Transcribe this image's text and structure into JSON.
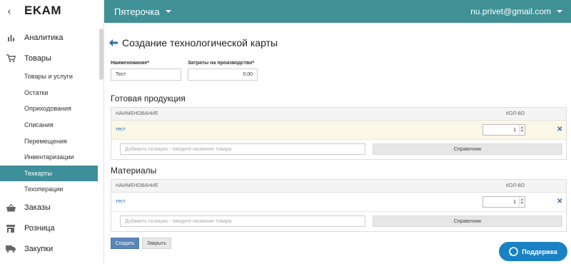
{
  "sidebar": {
    "back_glyph": "‹",
    "logo": "EKAM",
    "items": [
      {
        "label": "Аналитика",
        "icon": "bar-chart-icon",
        "type": "main"
      },
      {
        "label": "Товары",
        "icon": "cart-icon",
        "type": "main"
      },
      {
        "label": "Товары и услуги",
        "type": "sub"
      },
      {
        "label": "Остатки",
        "type": "sub"
      },
      {
        "label": "Оприходования",
        "type": "sub"
      },
      {
        "label": "Списания",
        "type": "sub"
      },
      {
        "label": "Перемещения",
        "type": "sub"
      },
      {
        "label": "Инвентаризации",
        "type": "sub"
      },
      {
        "label": "Техкарты",
        "type": "sub",
        "active": true
      },
      {
        "label": "Техоперации",
        "type": "sub"
      },
      {
        "label": "Заказы",
        "icon": "basket-icon",
        "type": "main"
      },
      {
        "label": "Розница",
        "icon": "store-icon",
        "type": "main"
      },
      {
        "label": "Закупки",
        "icon": "truck-icon",
        "type": "main"
      }
    ]
  },
  "topbar": {
    "store": "Пятерочка",
    "user_email": "nu.privet@gmail.com"
  },
  "page": {
    "title": "Создание технологической карты",
    "name_label": "Наименование*",
    "name_value": "Тест",
    "cost_label": "Затраты на производство*",
    "cost_value": "0,00"
  },
  "finished": {
    "title": "Готовая продукция",
    "col_name": "НАИМЕНОВАНИЕ",
    "col_qty": "КОЛ-ВО",
    "rows": [
      {
        "name": "тест",
        "qty": "1"
      }
    ],
    "add_placeholder": "Добавить позицию - введите название товара",
    "ref_button": "Справочник"
  },
  "materials": {
    "title": "Материалы",
    "col_name": "НАИМЕНОВАНИЕ",
    "col_qty": "КОЛ-ВО",
    "rows": [
      {
        "name": "тест",
        "qty": "1"
      }
    ],
    "add_placeholder": "Добавить позицию - введите название товара",
    "ref_button": "Справочник"
  },
  "actions": {
    "create": "Создать",
    "close": "Закрыть"
  },
  "support": {
    "label": "Поддержка"
  },
  "colors": {
    "topbar": "#3f9196",
    "active_nav": "#3e8f9a",
    "primary_button": "#5a86b8",
    "support_button": "#1a82c4",
    "link": "#2a6fb0",
    "highlight_row": "#fbf7e6"
  }
}
